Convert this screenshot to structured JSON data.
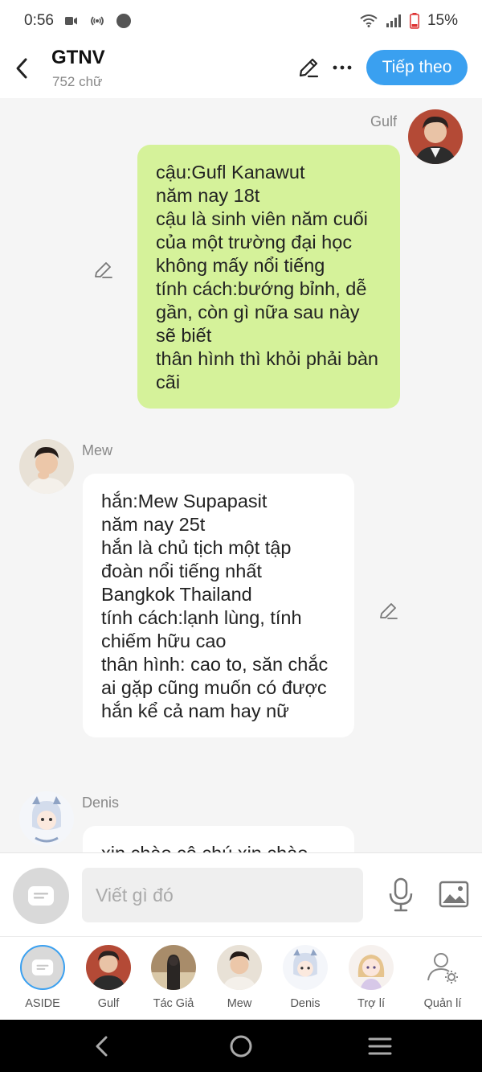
{
  "status": {
    "time": "0:56",
    "battery": "15%"
  },
  "header": {
    "title": "GTNV",
    "subtitle": "752 chữ",
    "next_label": "Tiếp theo"
  },
  "messages": [
    {
      "sender": "Gulf",
      "side": "right",
      "text": "cậu:Gufl Kanawut\nnăm nay 18t\ncậu là sinh viên năm cuối của một trường đại học không mấy nổi tiếng\ntính cách:bướng bỉnh, dễ gần, còn gì nữa sau này sẽ biết\nthân hình thì khỏi phải bàn cãi"
    },
    {
      "sender": "Mew",
      "side": "left",
      "text": "hắn:Mew Supapasit\nnăm nay 25t\nhắn là chủ tịch một tập đoàn nổi tiếng nhất Bangkok Thailand\ntính cách:lạnh lùng, tính chiếm hữu cao\nthân hình: cao to, săn chắc ai gặp cũng muốn có được hắn kể cả nam hay nữ"
    },
    {
      "sender": "Denis",
      "side": "left",
      "text": "xin chào cô chú xin chào"
    }
  ],
  "input": {
    "placeholder": "Viết gì đó"
  },
  "characters": [
    {
      "label": "ASIDE"
    },
    {
      "label": "Gulf"
    },
    {
      "label": "Tác Giả"
    },
    {
      "label": "Mew"
    },
    {
      "label": "Denis"
    },
    {
      "label": "Trợ lí"
    },
    {
      "label": "Quản lí"
    }
  ],
  "colors": {
    "accent": "#3aa0f0",
    "my_bubble": "#d5f29a",
    "other_bubble": "#ffffff",
    "background": "#f5f5f5"
  },
  "icons": [
    "back-icon",
    "edit-icon",
    "more-icon",
    "pencil-icon",
    "mic-icon",
    "image-icon",
    "aside-icon",
    "settings-user-icon"
  ]
}
